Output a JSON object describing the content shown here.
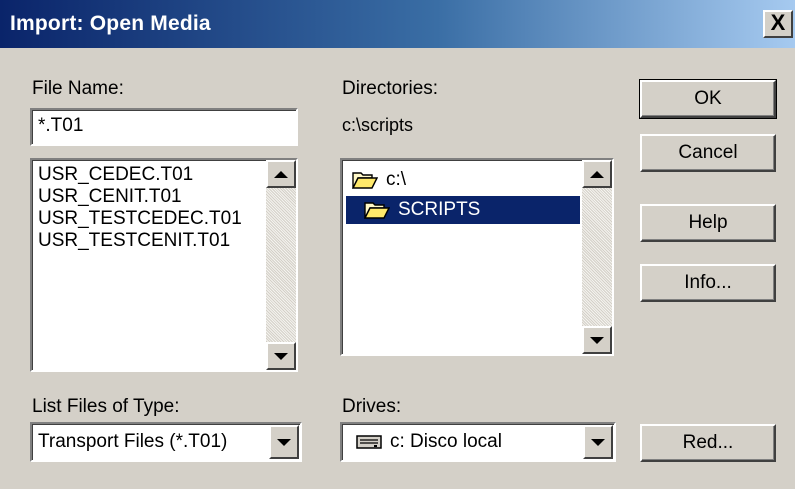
{
  "window": {
    "title": "Import: Open Media",
    "close_label": "X"
  },
  "file_name": {
    "label": "File Name:",
    "value": "*.T01"
  },
  "files": [
    "USR_CEDEC.T01",
    "USR_CENIT.T01",
    "USR_TESTCEDEC.T01",
    "USR_TESTCENIT.T01"
  ],
  "directories": {
    "label": "Directories:",
    "current_path": "c:\\scripts",
    "items": [
      {
        "label": "c:\\",
        "icon": "open-folder-icon",
        "selected": false
      },
      {
        "label": "SCRIPTS",
        "icon": "open-folder-icon",
        "selected": true
      }
    ]
  },
  "file_type": {
    "label": "List Files of Type:",
    "value": "Transport Files (*.T01)"
  },
  "drives": {
    "label": "Drives:",
    "value": "c: Disco local",
    "icon": "hard-drive-icon"
  },
  "buttons": {
    "ok": "OK",
    "cancel": "Cancel",
    "help": "Help",
    "info": "Info...",
    "network": "Red..."
  },
  "colors": {
    "selection": "#0a246a",
    "dialog_bg": "#d4d0c8",
    "titlebar_start": "#0a246a",
    "titlebar_end": "#a6caf0"
  }
}
